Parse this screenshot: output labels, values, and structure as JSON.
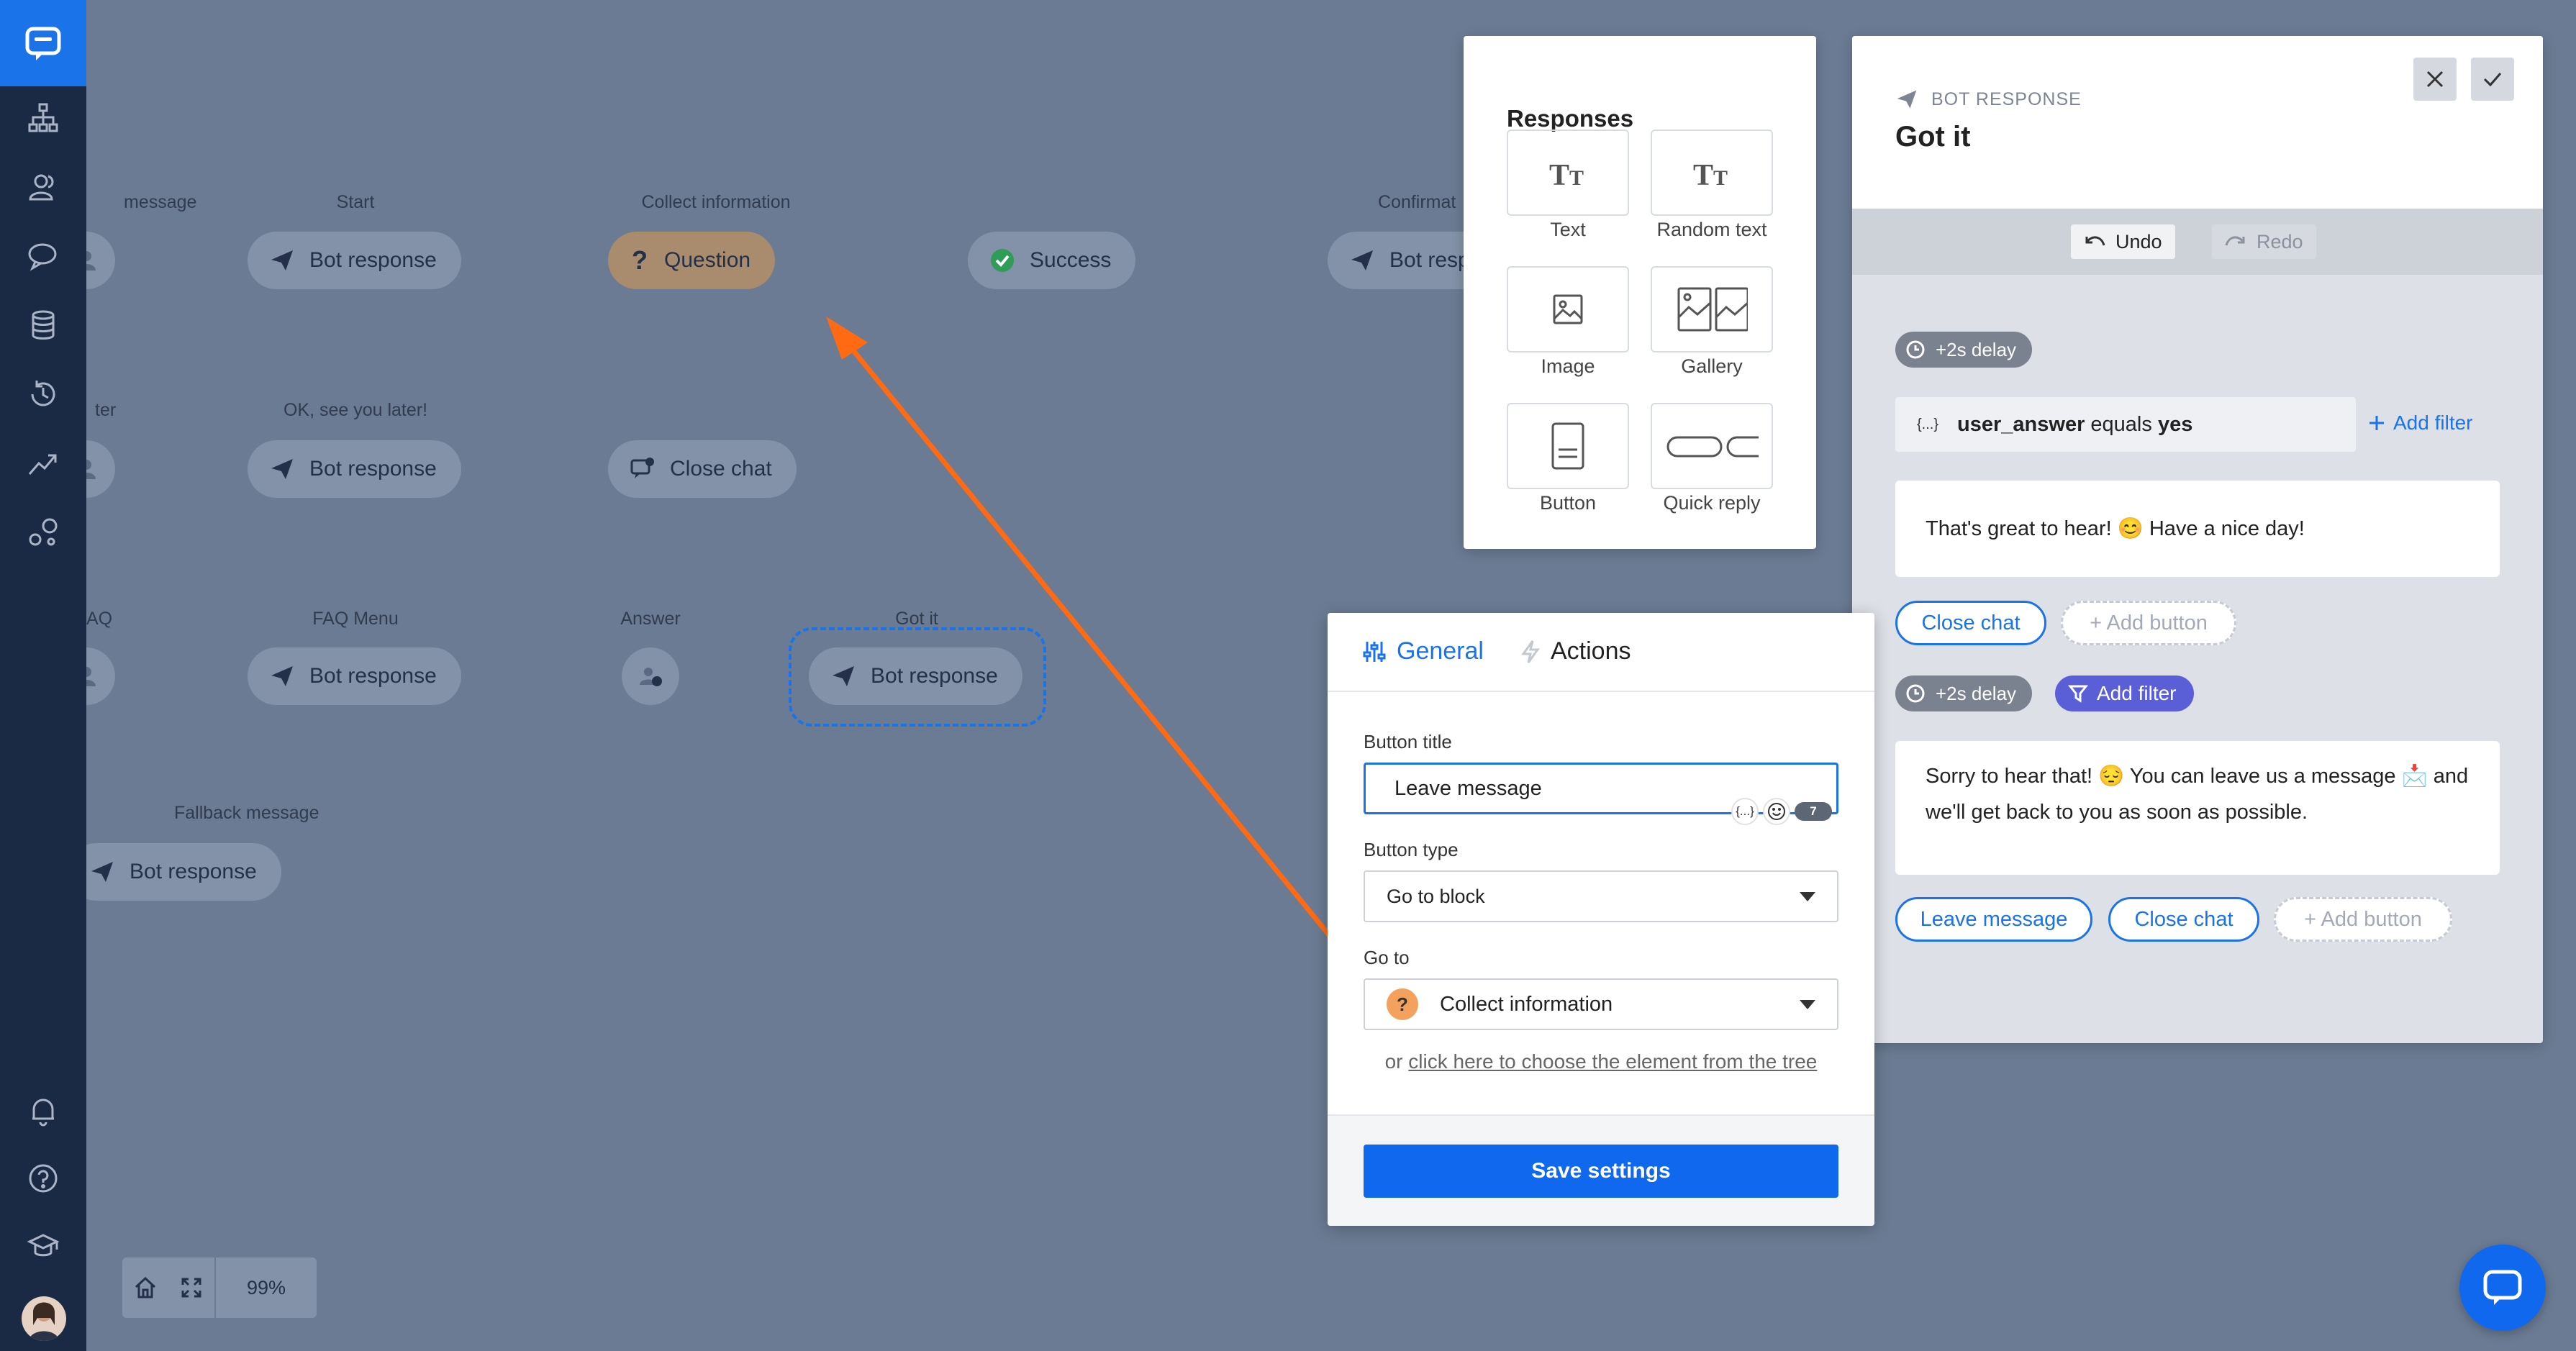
{
  "canvas": {
    "nodes": {
      "message_label": "message",
      "start_label": "Start",
      "start_node": "Bot response",
      "collect_label": "Collect information",
      "collect_node": "Question",
      "success_node": "Success",
      "confirm_label": "Confirmat",
      "confirm_node": "Bot resp",
      "after_label": "ter",
      "ok_label": "OK, see you later!",
      "ok_node": "Bot response",
      "close_node": "Close chat",
      "faq_label": "AQ",
      "faqmenu_label": "FAQ Menu",
      "faqmenu_node": "Bot response",
      "answer_label": "Answer",
      "gotit_label": "Got it",
      "gotit_node": "Bot response",
      "fallback_label": "Fallback message",
      "fallback_node": "Bot response"
    },
    "zoom": "99%"
  },
  "responses": {
    "title": "Responses",
    "tiles": [
      "Text",
      "Random text",
      "Image",
      "Gallery",
      "Button",
      "Quick reply"
    ]
  },
  "bot_panel": {
    "kicker": "BOT RESPONSE",
    "title": "Got it",
    "undo": "Undo",
    "redo": "Redo",
    "delay1": "+2s delay",
    "filter_var": "user_answer",
    "filter_op": "equals",
    "filter_val": "yes",
    "add_filter_link": "Add filter",
    "message1": "That's great to hear! 😊 Have a nice day!",
    "msg1_buttons": [
      "Close chat"
    ],
    "add_button": "+ Add button",
    "delay2": "+2s delay",
    "add_filter_pill": "Add filter",
    "message2": "Sorry to hear that! 😔 You can leave us a message 📩 and we'll get back to you as soon as possible.",
    "msg2_buttons": [
      "Leave message",
      "Close chat"
    ],
    "add_button2": "+ Add button"
  },
  "popup": {
    "tab_general": "General",
    "tab_actions": "Actions",
    "button_title_label": "Button title",
    "button_title_value": "Leave message",
    "var_glyph": "{...}",
    "char_count": "7",
    "button_type_label": "Button type",
    "button_type_value": "Go to block",
    "goto_label": "Go to",
    "goto_icon": "?",
    "goto_value": "Collect information",
    "hint_prefix": "or",
    "hint_link": "click here to choose the element from the tree",
    "save": "Save settings"
  },
  "colors": {
    "accent": "#1a73e8",
    "sidebar": "#1b2a44",
    "canvas_overlay": "#6b7b93",
    "arrow": "#ff6a13",
    "question_orange": "#f4a15d",
    "filter_violet": "#5a5fd8"
  }
}
